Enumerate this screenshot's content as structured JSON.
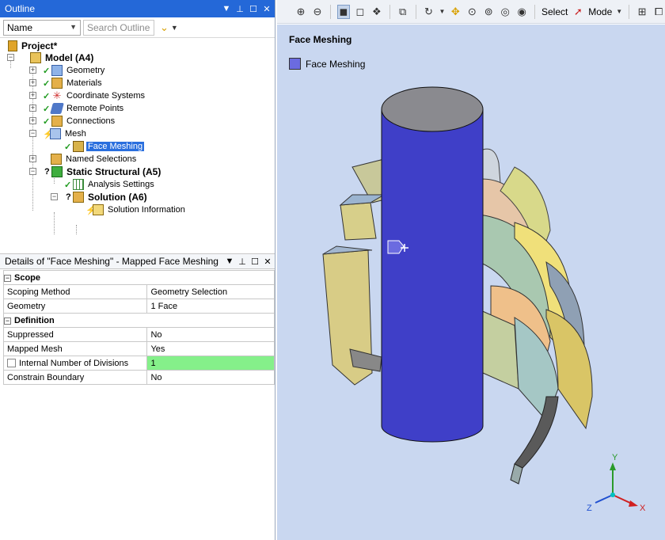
{
  "outline": {
    "title": "Outline",
    "filter_value": "Name",
    "search_placeholder": "Search Outline"
  },
  "tree": {
    "project": "Project*",
    "model": "Model (A4)",
    "geometry": "Geometry",
    "materials": "Materials",
    "coordinate_systems": "Coordinate Systems",
    "remote_points": "Remote Points",
    "connections": "Connections",
    "mesh": "Mesh",
    "face_meshing": "Face Meshing",
    "named_selections": "Named Selections",
    "static_structural": "Static Structural (A5)",
    "analysis_settings": "Analysis Settings",
    "solution": "Solution (A6)",
    "solution_information": "Solution Information"
  },
  "details": {
    "title": "Details of \"Face Meshing\" - Mapped Face Meshing",
    "scope_group": "Scope",
    "scoping_method_label": "Scoping Method",
    "scoping_method_value": "Geometry Selection",
    "geometry_label": "Geometry",
    "geometry_value": "1 Face",
    "definition_group": "Definition",
    "suppressed_label": "Suppressed",
    "suppressed_value": "No",
    "mapped_mesh_label": "Mapped Mesh",
    "mapped_mesh_value": "Yes",
    "divisions_label": "Internal Number of Divisions",
    "divisions_value": "1",
    "constrain_label": "Constrain Boundary",
    "constrain_value": "No"
  },
  "toolbar": {
    "select_label": "Select",
    "mode_label": "Mode"
  },
  "viewport": {
    "title": "Face Meshing",
    "legend_label": "Face Meshing",
    "legend_color": "#6b6be0",
    "axis_x": "X",
    "axis_y": "Y",
    "axis_z": "Z"
  },
  "colors": {
    "title_bar": "#2468d8",
    "selection": "#2a6fde",
    "highlight_cell": "#85f08a",
    "viewport_bg": "#c9d7f0",
    "cylinder": "#3f3fc8"
  }
}
